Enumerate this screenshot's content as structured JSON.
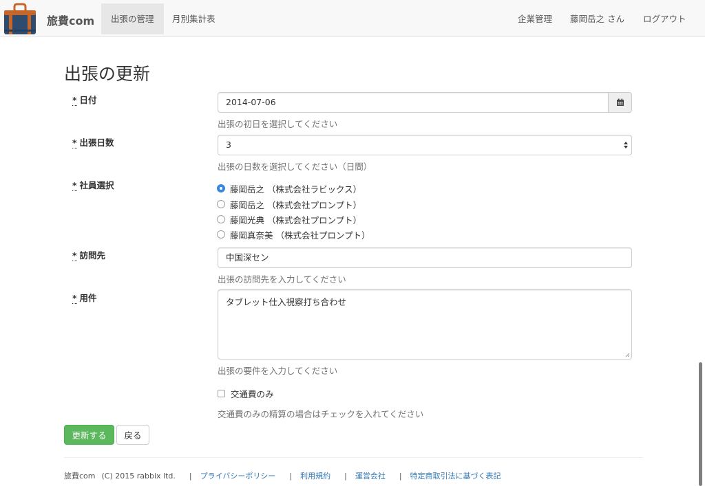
{
  "header": {
    "brand": "旅費com",
    "nav": [
      {
        "label": "出張の管理",
        "active": true
      },
      {
        "label": "月別集計表",
        "active": false
      }
    ],
    "right": [
      "企業管理",
      "藤岡岳之 さん",
      "ログアウト"
    ]
  },
  "page_title": "出張の更新",
  "required_mark": "*",
  "form": {
    "date": {
      "label": "日付",
      "value": "2014-07-06",
      "help": "出張の初日を選択してください",
      "icon": "calendar-icon"
    },
    "days": {
      "label": "出張日数",
      "value": "3",
      "help": "出張の日数を選択してください（日間）"
    },
    "employee": {
      "label": "社員選択",
      "options": [
        {
          "label": "藤岡岳之 （株式会社ラビックス）",
          "checked": true
        },
        {
          "label": "藤岡岳之 （株式会社プロンプト）",
          "checked": false
        },
        {
          "label": "藤岡光典 （株式会社プロンプト）",
          "checked": false
        },
        {
          "label": "藤岡真奈美 （株式会社プロンプト）",
          "checked": false
        }
      ]
    },
    "destination": {
      "label": "訪問先",
      "value": "中国深セン",
      "help": "出張の訪問先を入力してください"
    },
    "purpose": {
      "label": "用件",
      "value": "タブレット仕入視察打ち合わせ",
      "help": "出張の要件を入力してください"
    },
    "transport_only": {
      "label": "交通費のみ",
      "checked": false,
      "help": "交通費のみの精算の場合はチェックを入れてください"
    }
  },
  "buttons": {
    "submit": "更新する",
    "back": "戻る"
  },
  "footer": {
    "copyright_brand": "旅費com",
    "copyright": "(C) 2015 rabbix ltd.",
    "separator": "|",
    "links": [
      "プライバシーポリシー",
      "利用規約",
      "運営会社",
      "特定商取引法に基づく表記"
    ]
  },
  "colors": {
    "primary": "#5cb85c",
    "link": "#337ab7",
    "radio": "#3a87e0"
  }
}
